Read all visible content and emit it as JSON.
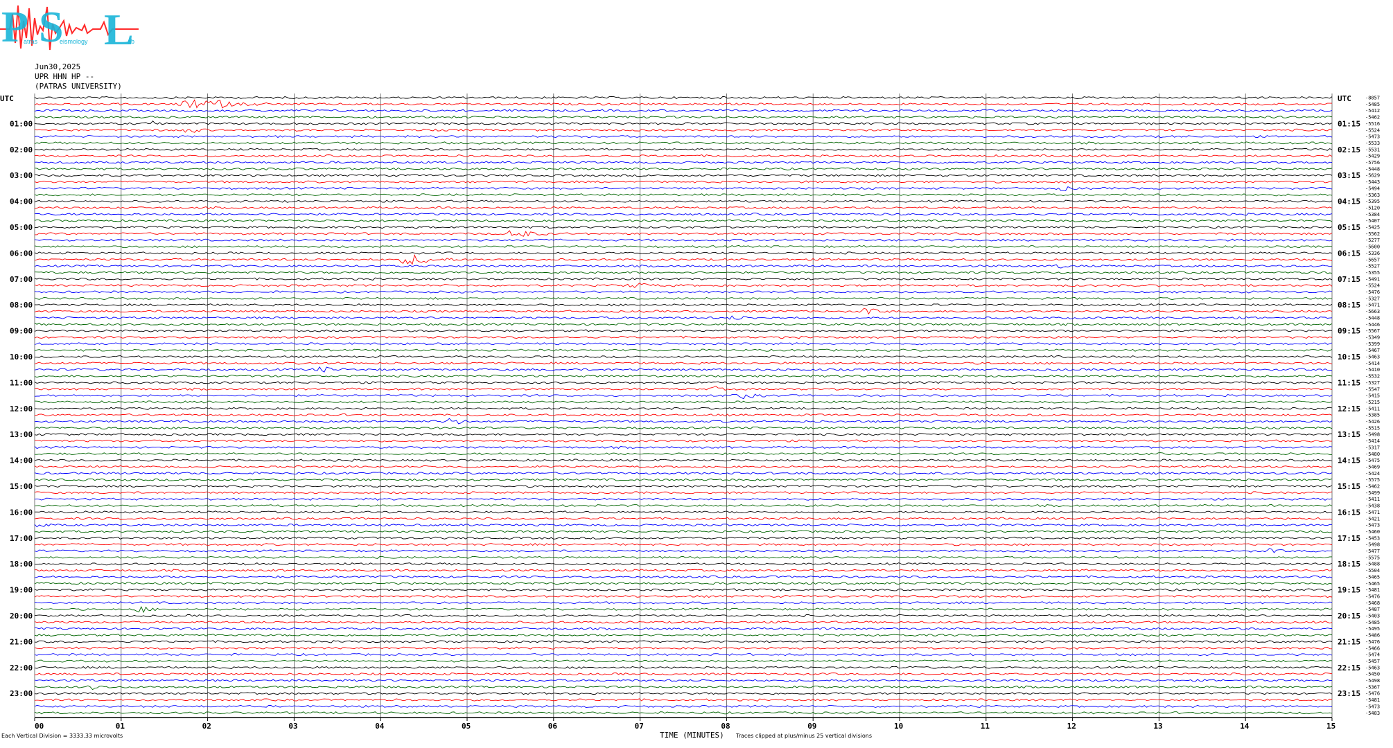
{
  "logo": {
    "letters": [
      "P",
      "S",
      "L"
    ],
    "words": [
      "atras",
      "eismology",
      "ab"
    ],
    "colors": {
      "letters": "#19b5d8",
      "waveform": "#ff2a2a"
    }
  },
  "header": {
    "date": "Jun30,2025",
    "station": "UPR HHN HP --",
    "institution": "(PATRAS UNIVERSITY)"
  },
  "footer": {
    "scale_note": "Each Vertical Division = 3333.33 microvolts",
    "axis_title": "TIME (MINUTES)",
    "clip_note": "Traces clipped at plus/minus 25 vertical divisions"
  },
  "chart_data": {
    "type": "helicorder",
    "xlabel": "TIME (MINUTES)",
    "xlim": [
      0,
      15
    ],
    "x_ticks": [
      "00",
      "01",
      "02",
      "03",
      "04",
      "05",
      "06",
      "07",
      "08",
      "09",
      "10",
      "11",
      "12",
      "13",
      "14",
      "15"
    ],
    "grid": true,
    "left_axis_title": "UTC",
    "right_axis_title": "UTC",
    "left_hour_labels": [
      "01:00",
      "02:00",
      "03:00",
      "04:00",
      "05:00",
      "06:00",
      "07:00",
      "08:00",
      "09:00",
      "10:00",
      "11:00",
      "12:00",
      "13:00",
      "14:00",
      "15:00",
      "16:00",
      "17:00",
      "18:00",
      "19:00",
      "20:00",
      "21:00",
      "22:00",
      "23:00"
    ],
    "right_hour_labels": [
      "01:15",
      "02:15",
      "03:15",
      "04:15",
      "05:15",
      "06:15",
      "07:15",
      "08:15",
      "09:15",
      "10:15",
      "11:15",
      "12:15",
      "13:15",
      "14:15",
      "15:15",
      "16:15",
      "17:15",
      "18:15",
      "19:15",
      "20:15",
      "21:15",
      "22:15",
      "23:15"
    ],
    "trace_colors": [
      "#000000",
      "#ff0000",
      "#0000ff",
      "#006400"
    ],
    "trace_count": 96,
    "minutes_per_trace": 15,
    "trace_offsets": [
      "-8857",
      "-5485",
      "-5412",
      "-5462",
      "-5516",
      "-5524",
      "-5473",
      "-5533",
      "-5531",
      "-5429",
      "-5756",
      "-5448",
      "-5629",
      "-5443",
      "-5494",
      "-5363",
      "-5395",
      "-5120",
      "-5384",
      "-5407",
      "-5425",
      "-5562",
      "-5277",
      "-5600",
      "-5336",
      "-5657",
      "-5527",
      "-5355",
      "-5491",
      "-5524",
      "-5476",
      "-5327",
      "-5471",
      "-5663",
      "-5448",
      "-5446",
      "-5567",
      "-5349",
      "-5399",
      "-5467",
      "-5463",
      "-5414",
      "-5410",
      "-5532",
      "-5327",
      "-5547",
      "-5415",
      "-5215",
      "-5411",
      "-5385",
      "-5426",
      "-5515",
      "-5498",
      "-5414",
      "-5317",
      "-5480",
      "-5475",
      "-5469",
      "-5424",
      "-5575",
      "-5462",
      "-5499",
      "-5411",
      "-5438",
      "-5471",
      "-5421",
      "-5473",
      "-5460",
      "-5453",
      "-5498",
      "-5477",
      "-5575",
      "-5488",
      "-5504",
      "-5465",
      "-5465",
      "-5481",
      "-5476",
      "-5468",
      "-5487",
      "-5403",
      "-5485",
      "-5495",
      "-5486",
      "-5476",
      "-5466",
      "-5474",
      "-5457",
      "-5463",
      "-5450",
      "-5498",
      "-5367",
      "-5476",
      "-5481",
      "-5473",
      "-5483"
    ],
    "events": [
      {
        "trace": 1,
        "start_min": 1.6,
        "end_min": 2.8,
        "amplitude": 1.0
      },
      {
        "trace": 4,
        "start_min": 1.35,
        "end_min": 1.45,
        "amplitude": 0.9
      },
      {
        "trace": 5,
        "start_min": 1.7,
        "end_min": 2.0,
        "amplitude": 0.8
      },
      {
        "trace": 14,
        "start_min": 11.8,
        "end_min": 12.1,
        "amplitude": 0.4
      },
      {
        "trace": 21,
        "start_min": 5.4,
        "end_min": 6.0,
        "amplitude": 0.9
      },
      {
        "trace": 25,
        "start_min": 4.15,
        "end_min": 4.9,
        "amplitude": 1.0
      },
      {
        "trace": 26,
        "start_min": 11.8,
        "end_min": 12.0,
        "amplitude": 0.5
      },
      {
        "trace": 29,
        "start_min": 6.8,
        "end_min": 7.4,
        "amplitude": 0.4
      },
      {
        "trace": 33,
        "start_min": 9.5,
        "end_min": 9.9,
        "amplitude": 0.6
      },
      {
        "trace": 34,
        "start_min": 8.0,
        "end_min": 8.4,
        "amplitude": 0.4
      },
      {
        "trace": 42,
        "start_min": 3.2,
        "end_min": 3.6,
        "amplitude": 0.5
      },
      {
        "trace": 45,
        "start_min": 7.8,
        "end_min": 8.0,
        "amplitude": 0.5
      },
      {
        "trace": 46,
        "start_min": 8.1,
        "end_min": 8.5,
        "amplitude": 0.6
      },
      {
        "trace": 50,
        "start_min": 4.7,
        "end_min": 5.1,
        "amplitude": 0.7
      },
      {
        "trace": 66,
        "start_min": 0.0,
        "end_min": 0.2,
        "amplitude": 0.7
      },
      {
        "trace": 70,
        "start_min": 14.2,
        "end_min": 14.5,
        "amplitude": 0.4
      },
      {
        "trace": 79,
        "start_min": 1.1,
        "end_min": 1.5,
        "amplitude": 0.6
      },
      {
        "trace": 91,
        "start_min": 0.6,
        "end_min": 0.9,
        "amplitude": 0.5
      }
    ]
  }
}
